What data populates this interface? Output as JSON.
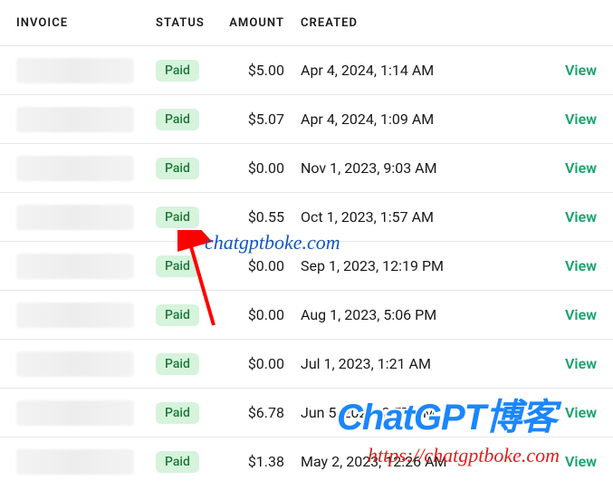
{
  "headers": {
    "invoice": "INVOICE",
    "status": "STATUS",
    "amount": "AMOUNT",
    "created": "CREATED"
  },
  "status_labels": {
    "paid": "Paid"
  },
  "view_label": "View",
  "rows": [
    {
      "status": "paid",
      "amount": "$5.00",
      "created": "Apr 4, 2024, 1:14 AM"
    },
    {
      "status": "paid",
      "amount": "$5.07",
      "created": "Apr 4, 2024, 1:09 AM"
    },
    {
      "status": "paid",
      "amount": "$0.00",
      "created": "Nov 1, 2023, 9:03 AM"
    },
    {
      "status": "paid",
      "amount": "$0.55",
      "created": "Oct 1, 2023, 1:57 AM"
    },
    {
      "status": "paid",
      "amount": "$0.00",
      "created": "Sep 1, 2023, 12:19 PM"
    },
    {
      "status": "paid",
      "amount": "$0.00",
      "created": "Aug 1, 2023, 5:06 PM"
    },
    {
      "status": "paid",
      "amount": "$0.00",
      "created": "Jul 1, 2023, 1:21 AM"
    },
    {
      "status": "paid",
      "amount": "$6.78",
      "created": "Jun 5, 2023, 2:57 AM"
    },
    {
      "status": "paid",
      "amount": "$1.38",
      "created": "May 2, 2023, 12:26 AM"
    }
  ],
  "watermark": {
    "top_text": "chatgptboke.com",
    "logo_text": "ChatGPT博客",
    "bottom_url": "https://chatgptboke.com"
  },
  "colors": {
    "view_link": "#15a36b",
    "paid_bg": "#d6f3dc",
    "paid_fg": "#1f7a3a",
    "arrow": "#ff0000"
  }
}
